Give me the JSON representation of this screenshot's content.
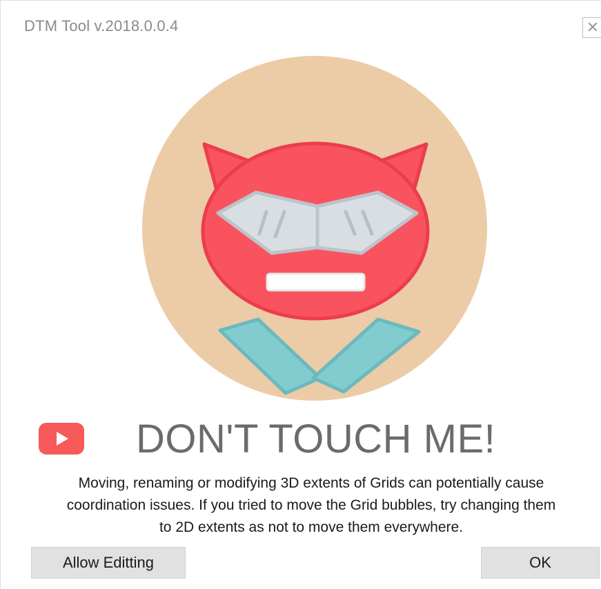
{
  "window": {
    "title": "DTM Tool v.2018.0.0.4",
    "close_glyph": "✕"
  },
  "hero": {
    "icon": "devil-robot-mascot-icon",
    "colors": {
      "circle": "#eccba7",
      "head": "#f8535f",
      "head_stroke": "#ec3d4c",
      "visor": "#d9dee3",
      "visor_stroke": "#bcc4cb",
      "collar": "#82cccf",
      "collar_stroke": "#6ab9bd"
    }
  },
  "banner": {
    "icon": "youtube-icon",
    "icon_color": "#f85959",
    "headline": "DON'T TOUCH ME!"
  },
  "message": {
    "lines": [
      "Moving, renaming or modifying 3D extents of Grids can potentially cause",
      "coordination issues. If you tried to move the Grid bubbles, try changing them",
      "to 2D extents as not to move them everywhere."
    ]
  },
  "buttons": {
    "allow_label": "Allow Editting",
    "ok_label": "OK"
  }
}
